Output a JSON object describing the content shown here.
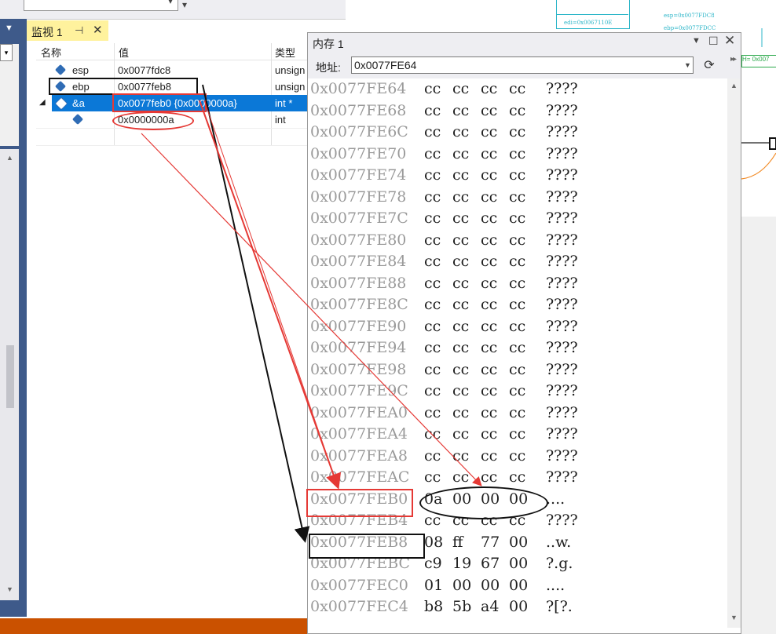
{
  "watch": {
    "tab_title": "监视 1",
    "pin_glyph": "⊣",
    "close_glyph": "✕",
    "columns": {
      "name": "名称",
      "value": "值",
      "type": "类型"
    },
    "rows": [
      {
        "name": "esp",
        "value": "0x0077fdc8",
        "type": "unsign"
      },
      {
        "name": "ebp",
        "value": "0x0077feb8",
        "type": "unsign"
      },
      {
        "name": "&a",
        "value": "0x0077feb0 {0x0000000a}",
        "type": "int *"
      },
      {
        "name": "",
        "value": "0x0000000a",
        "type": "int"
      }
    ]
  },
  "memory": {
    "title": "内存 1",
    "address_label": "地址:",
    "address_value": "0x0077FE64",
    "rows": [
      {
        "addr": "0x0077FE64",
        "bytes": [
          "cc",
          "cc",
          "cc",
          "cc"
        ],
        "ascii": "????"
      },
      {
        "addr": "0x0077FE68",
        "bytes": [
          "cc",
          "cc",
          "cc",
          "cc"
        ],
        "ascii": "????"
      },
      {
        "addr": "0x0077FE6C",
        "bytes": [
          "cc",
          "cc",
          "cc",
          "cc"
        ],
        "ascii": "????"
      },
      {
        "addr": "0x0077FE70",
        "bytes": [
          "cc",
          "cc",
          "cc",
          "cc"
        ],
        "ascii": "????"
      },
      {
        "addr": "0x0077FE74",
        "bytes": [
          "cc",
          "cc",
          "cc",
          "cc"
        ],
        "ascii": "????"
      },
      {
        "addr": "0x0077FE78",
        "bytes": [
          "cc",
          "cc",
          "cc",
          "cc"
        ],
        "ascii": "????"
      },
      {
        "addr": "0x0077FE7C",
        "bytes": [
          "cc",
          "cc",
          "cc",
          "cc"
        ],
        "ascii": "????"
      },
      {
        "addr": "0x0077FE80",
        "bytes": [
          "cc",
          "cc",
          "cc",
          "cc"
        ],
        "ascii": "????"
      },
      {
        "addr": "0x0077FE84",
        "bytes": [
          "cc",
          "cc",
          "cc",
          "cc"
        ],
        "ascii": "????"
      },
      {
        "addr": "0x0077FE88",
        "bytes": [
          "cc",
          "cc",
          "cc",
          "cc"
        ],
        "ascii": "????"
      },
      {
        "addr": "0x0077FE8C",
        "bytes": [
          "cc",
          "cc",
          "cc",
          "cc"
        ],
        "ascii": "????"
      },
      {
        "addr": "0x0077FE90",
        "bytes": [
          "cc",
          "cc",
          "cc",
          "cc"
        ],
        "ascii": "????"
      },
      {
        "addr": "0x0077FE94",
        "bytes": [
          "cc",
          "cc",
          "cc",
          "cc"
        ],
        "ascii": "????"
      },
      {
        "addr": "0x0077FE98",
        "bytes": [
          "cc",
          "cc",
          "cc",
          "cc"
        ],
        "ascii": "????"
      },
      {
        "addr": "0x0077FE9C",
        "bytes": [
          "cc",
          "cc",
          "cc",
          "cc"
        ],
        "ascii": "????"
      },
      {
        "addr": "0x0077FEA0",
        "bytes": [
          "cc",
          "cc",
          "cc",
          "cc"
        ],
        "ascii": "????"
      },
      {
        "addr": "0x0077FEA4",
        "bytes": [
          "cc",
          "cc",
          "cc",
          "cc"
        ],
        "ascii": "????"
      },
      {
        "addr": "0x0077FEA8",
        "bytes": [
          "cc",
          "cc",
          "cc",
          "cc"
        ],
        "ascii": "????"
      },
      {
        "addr": "0x0077FEAC",
        "bytes": [
          "cc",
          "cc",
          "cc",
          "cc"
        ],
        "ascii": "????"
      },
      {
        "addr": "0x0077FEB0",
        "bytes": [
          "0a",
          "00",
          "00",
          "00"
        ],
        "ascii": "...."
      },
      {
        "addr": "0x0077FEB4",
        "bytes": [
          "cc",
          "cc",
          "cc",
          "cc"
        ],
        "ascii": "????"
      },
      {
        "addr": "0x0077FEB8",
        "bytes": [
          "08",
          "ff",
          "77",
          "00"
        ],
        "ascii": "..w."
      },
      {
        "addr": "0x0077FEBC",
        "bytes": [
          "c9",
          "19",
          "67",
          "00"
        ],
        "ascii": "?.g."
      },
      {
        "addr": "0x0077FEC0",
        "bytes": [
          "01",
          "00",
          "00",
          "00"
        ],
        "ascii": "...."
      },
      {
        "addr": "0x0077FEC4",
        "bytes": [
          "b8",
          "5b",
          "a4",
          "00"
        ],
        "ascii": "?[?."
      }
    ]
  },
  "background": {
    "diagram_label_1": "esp=0x0077FDC8",
    "diagram_label_2": "edi=0x0067110E",
    "diagram_label_3": "ebp=0x0077FDCC",
    "diagram_label_green": "H= 0x007"
  },
  "colors": {
    "accent_selection": "#0b78d7",
    "annotation_red": "#e53935",
    "annotation_black": "#111111",
    "watch_tab": "#fff29d",
    "status_bar": "#ca5100"
  }
}
